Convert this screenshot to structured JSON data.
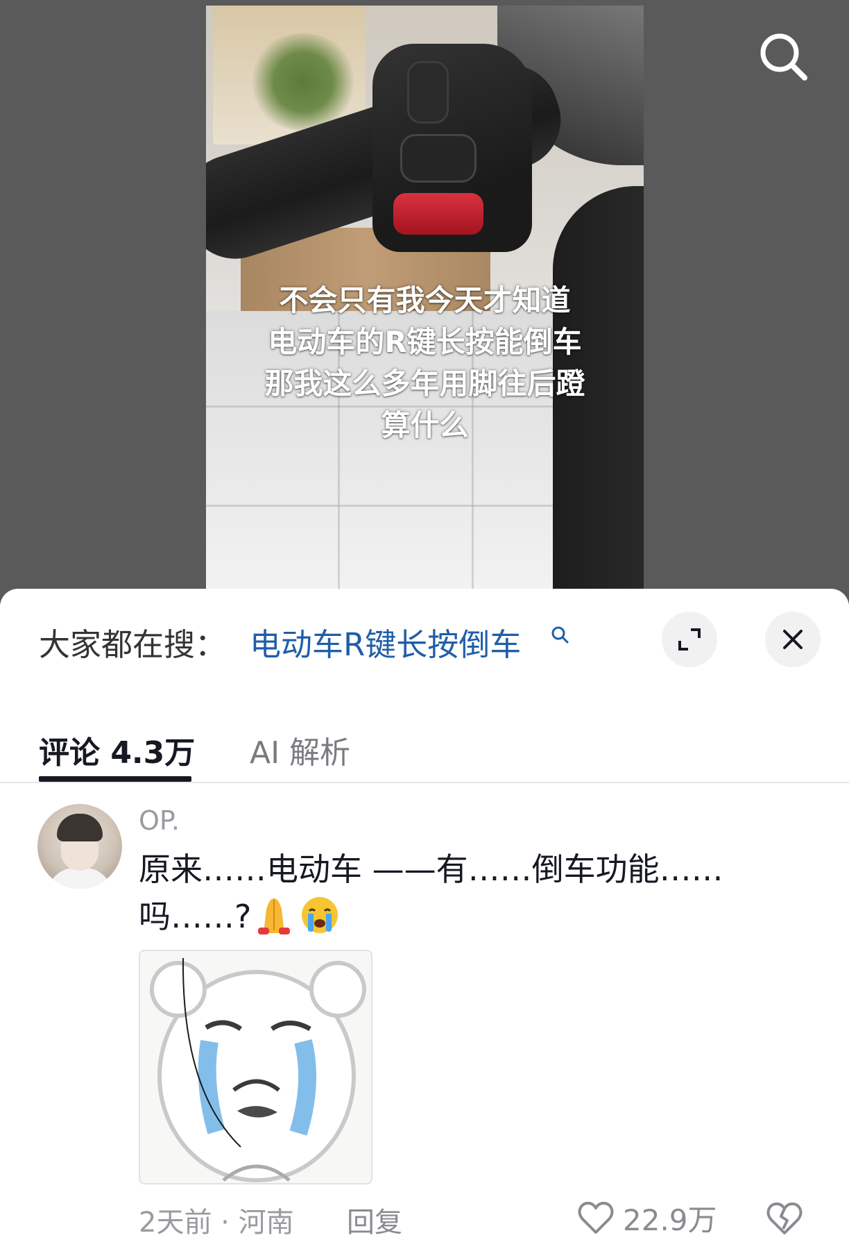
{
  "video": {
    "caption_lines": [
      "不会只有我今天才知道",
      "电动车的R键长按能倒车",
      "那我这么多年用脚往后蹬",
      "算什么"
    ]
  },
  "sheet": {
    "search_prefix": "大家都在搜：",
    "search_term": "电动车R键长按倒车",
    "tabs": [
      {
        "label": "评论 4.3万",
        "active": true
      },
      {
        "label": "AI 解析",
        "active": false
      }
    ],
    "comment": {
      "username": "OP.",
      "text_line1": "原来……电动车 ——有……倒车功能……",
      "text_line2": "吗……?",
      "meta": "2天前 · 河南",
      "reply_label": "回复",
      "like_count": "22.9万"
    }
  },
  "colors": {
    "link_blue": "#1f5ea8",
    "muted_gray": "#9a9ba0",
    "text_dark": "#161823"
  },
  "icons": [
    "search-icon",
    "search-term-icon",
    "expand-icon",
    "close-icon",
    "heart-icon",
    "broken-heart-icon"
  ]
}
